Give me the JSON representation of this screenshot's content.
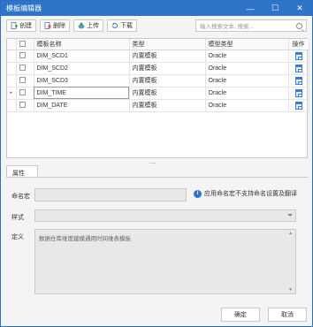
{
  "window": {
    "title": "模板编辑器"
  },
  "toolbar": {
    "create_label": "创建",
    "delete_label": "删除",
    "upload_label": "上传",
    "download_label": "下载",
    "search_placeholder": "输入搜索文本, 搜索..."
  },
  "grid": {
    "columns": [
      "模板名称",
      "类型",
      "模型类型",
      "操作"
    ],
    "rows": [
      {
        "name": "DIM_SCD1",
        "type": "内置模板",
        "model_type": "Oracle"
      },
      {
        "name": "DIM_SCD2",
        "type": "内置模板",
        "model_type": "Oracle"
      },
      {
        "name": "DIM_SCD3",
        "type": "内置模板",
        "model_type": "Oracle"
      },
      {
        "name": "DIM_TIME",
        "type": "内置模板",
        "model_type": "Oracle"
      },
      {
        "name": "DIM_DATE",
        "type": "内置模板",
        "model_type": "Oracle"
      }
    ],
    "current_row_marker": "▸"
  },
  "splitter_label": "....",
  "properties": {
    "tab_label": "属性",
    "naming_label": "命名宏",
    "naming_value": "",
    "naming_note": "应用命名宏不支持命名设置及翻译",
    "style_label": "样式",
    "style_value": "",
    "definition_label": "定义",
    "definition_value": "数据仓库维度建模通用时间维表模板"
  },
  "footer": {
    "ok_label": "确定",
    "cancel_label": "取消"
  },
  "colors": {
    "accent": "#2e74c8",
    "border": "#c9c9c9",
    "background": "#f4f4f4"
  }
}
